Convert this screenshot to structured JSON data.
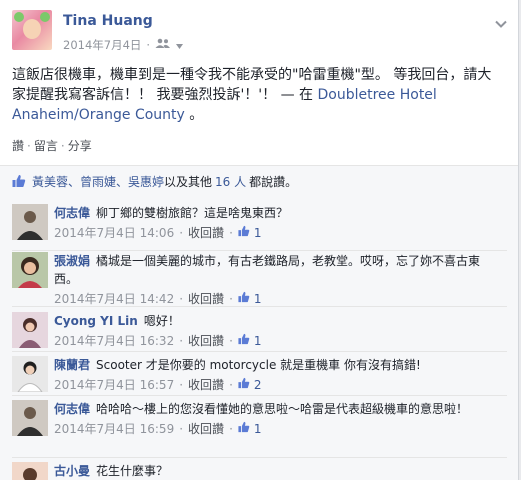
{
  "post": {
    "author": "Tina Huang",
    "date": "2014年7月4日",
    "text_main": "這飯店很機車，機車到是一種令我不能承受的\"哈雷重機\"型。 等我回台，請大家提醒我寫客訴信！！ 我要強烈投訴'！'！ — 在 ",
    "text_link": "Doubletree Hotel Anaheim/Orange County",
    "text_end": " 。",
    "actions": [
      "讚",
      "留言",
      "分享"
    ],
    "audience_icon": "friends-icon"
  },
  "likes": {
    "names": "黃美蓉、曾雨婕、吳惠婷",
    "connector": "以及其他",
    "others": "16 人",
    "suffix": "都說讚。"
  },
  "comments": [
    {
      "name": "何志偉",
      "text": "柳丁鄉的雙樹旅館？這是啥鬼東西？",
      "date": "2014年7月4日 14:06",
      "reply": "收回讚",
      "likes": "1"
    },
    {
      "name": "張淑娟",
      "text": "橘城是一個美麗的城市，有古老鐵路局，老教堂。哎呀，忘了妳不喜古東西。",
      "date": "2014年7月4日 14:42",
      "reply": "收回讚",
      "likes": "1"
    },
    {
      "name": "Cyong YI Lin",
      "text": "嗯好！",
      "date": "2014年7月4日 16:32",
      "reply": "收回讚",
      "likes": "1"
    },
    {
      "name": "陳蘭君",
      "text": "Scooter 才是你要的 motorcycle 就是重機車 你有沒有搞錯!",
      "date": "2014年7月4日 16:57",
      "reply": "收回讚",
      "likes": "2"
    },
    {
      "name": "何志偉",
      "text": "哈哈哈～樓上的您沒看懂她的意思啦～哈雷是代表超級機車的意思啦！",
      "date": "2014年7月4日 16:59",
      "reply": "收回讚",
      "likes": "1"
    },
    {
      "name": "古小曼",
      "text": "花生什麼事？",
      "date": "",
      "reply": "",
      "likes": ""
    }
  ],
  "colors": {
    "link": "#3b5998",
    "meta": "#90949c",
    "bg": "#f6f7f9"
  }
}
